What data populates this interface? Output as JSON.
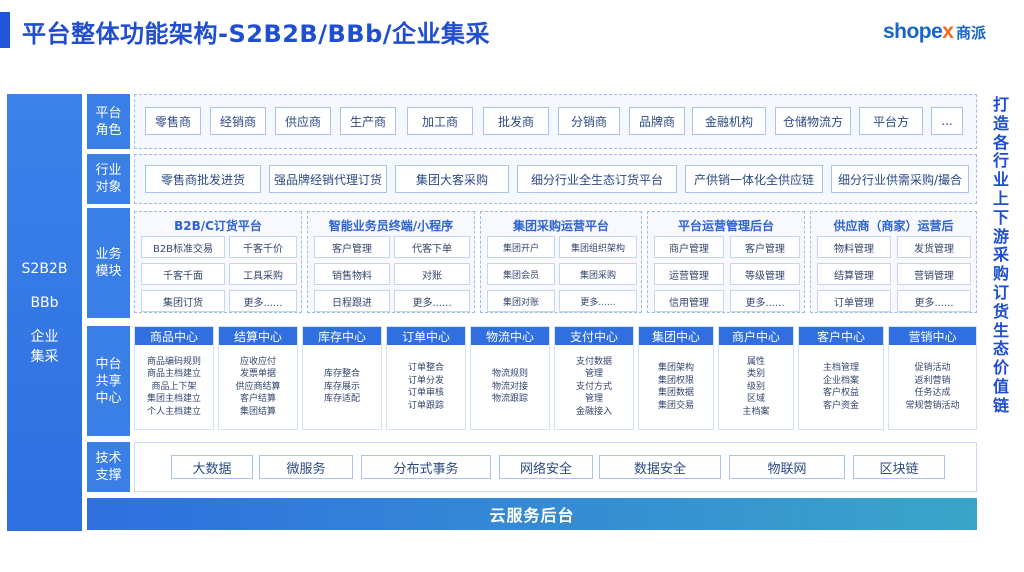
{
  "title": "平台整体功能架构-S2B2B/BBb/企业集采",
  "brand": {
    "shop": "shope",
    "x": "x",
    "cn": "商派"
  },
  "left_panel": {
    "line1": "S2B2B",
    "line2": "BBb",
    "line3": "企业",
    "line4": "集采"
  },
  "rows": {
    "roles": {
      "label": "平台角色",
      "items": [
        "零售商",
        "经销商",
        "供应商",
        "生产商",
        "加工商",
        "批发商",
        "分销商",
        "品牌商",
        "金融机构",
        "仓储物流方",
        "平台方",
        "..."
      ]
    },
    "targets": {
      "label": "行业对象",
      "items": [
        "零售商批发进货",
        "强品牌经销代理订货",
        "集团大客采购",
        "细分行业全生态订货平台",
        "产供销一体化全供应链",
        "细分行业供需采购/撮合"
      ]
    },
    "modules": {
      "label": "业务模块",
      "groups": [
        {
          "title": "B2B/C订货平台",
          "items": [
            "B2B标准交易",
            "千客千价",
            "千客千面",
            "工具采购",
            "集团订货",
            "更多......"
          ]
        },
        {
          "title": "智能业务员终端/小程序",
          "items": [
            "客户管理",
            "代客下单",
            "销售物料",
            "对账",
            "日程跟进",
            "更多......"
          ]
        },
        {
          "title": "集团采购运营平台",
          "items": [
            "集团开户",
            "集团组织架构",
            "集团会员",
            "集团采购",
            "集团对账",
            "更多......"
          ]
        },
        {
          "title": "平台运营管理后台",
          "items": [
            "商户管理",
            "客户管理",
            "运营管理",
            "等级管理",
            "信用管理",
            "更多......"
          ]
        },
        {
          "title": "供应商（商家）运营后",
          "items": [
            "物料管理",
            "发货管理",
            "结算管理",
            "营销管理",
            "订单管理",
            "更多......"
          ]
        }
      ]
    },
    "middle": {
      "label": "中台共享中心",
      "centers": [
        {
          "name": "商品中心",
          "items": [
            "商品编码规则",
            "商品主档建立",
            "商品上下架",
            "集团主档建立",
            "个人主档建立"
          ]
        },
        {
          "name": "结算中心",
          "items": [
            "应收应付",
            "发票单据",
            "供应商结算",
            "客户结算",
            "集团结算"
          ]
        },
        {
          "name": "库存中心",
          "items": [
            "库存整合",
            "库存展示",
            "库存适配"
          ]
        },
        {
          "name": "订单中心",
          "items": [
            "订单整合",
            "订单分发",
            "订单审核",
            "订单跟踪"
          ]
        },
        {
          "name": "物流中心",
          "items": [
            "物流规则",
            "物流对接",
            "物流跟踪"
          ]
        },
        {
          "name": "支付中心",
          "items": [
            "支付数据",
            "管理",
            "支付方式",
            "管理",
            "金融接入"
          ]
        },
        {
          "name": "集团中心",
          "items": [
            "集团架构",
            "集团权限",
            "集团数据",
            "集团交易"
          ]
        },
        {
          "name": "商户中心",
          "items": [
            "属性",
            "类别",
            "级别",
            "区域",
            "主档案"
          ]
        },
        {
          "name": "客户中心",
          "items": [
            "主档管理",
            "企业档案",
            "客户权益",
            "客户资金"
          ]
        },
        {
          "name": "营销中心",
          "items": [
            "促销活动",
            "返利营销",
            "任务达成",
            "常规营销活动"
          ]
        }
      ]
    },
    "tech": {
      "label": "技术支撑",
      "items": [
        "大数据",
        "微服务",
        "分布式事务",
        "网络安全",
        "数据安全",
        "物联网",
        "区块链"
      ]
    }
  },
  "cloud": "云服务后台",
  "right_text": "打造各行业上下游采购订货生态价值链",
  "colors": {
    "primary": "#2f6fe0",
    "title": "#1f4fd0",
    "brand_orange": "#f26a1b"
  }
}
